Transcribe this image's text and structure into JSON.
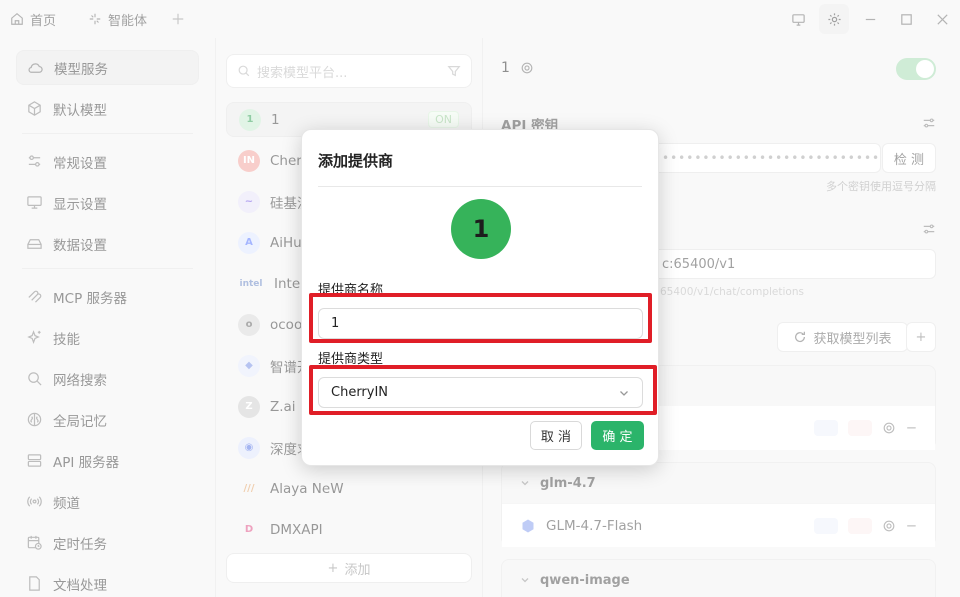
{
  "titlebar": {
    "tabs": [
      {
        "label": "首页",
        "icon": "home-icon"
      },
      {
        "label": "智能体",
        "icon": "sparkle-icon"
      }
    ]
  },
  "nav": {
    "items": [
      {
        "label": "模型服务",
        "icon": "cloud-icon",
        "active": true
      },
      {
        "label": "默认模型",
        "icon": "cube-icon"
      },
      {
        "label": "常规设置",
        "icon": "sliders-icon"
      },
      {
        "label": "显示设置",
        "icon": "monitor-icon"
      },
      {
        "label": "数据设置",
        "icon": "drive-icon"
      },
      {
        "label": "MCP 服务器",
        "icon": "mcp-icon"
      },
      {
        "label": "技能",
        "icon": "sparkles-icon"
      },
      {
        "label": "网络搜索",
        "icon": "search-icon"
      },
      {
        "label": "全局记忆",
        "icon": "brain-icon"
      },
      {
        "label": "API 服务器",
        "icon": "server-icon"
      },
      {
        "label": "频道",
        "icon": "broadcast-icon"
      },
      {
        "label": "定时任务",
        "icon": "calendar-clock-icon"
      },
      {
        "label": "文档处理",
        "icon": "file-icon"
      }
    ]
  },
  "providers": {
    "search_placeholder": "搜索模型平台...",
    "items": [
      {
        "label": "1",
        "badge": "ON",
        "logo_text": "1",
        "logo_color": "#c9ecd2",
        "logo_text_color": "#36a35a"
      },
      {
        "label": "CherryIN",
        "logo_text": "IN",
        "logo_color": "#f2a7a0"
      },
      {
        "label": "硅基流动",
        "logo_text": "~",
        "logo_color": "#e7e3f7",
        "logo_text_color": "#7b5ee6"
      },
      {
        "label": "AiHubMix",
        "logo_text": "A",
        "logo_color": "#dfe7ff",
        "logo_text_color": "#5b7bff"
      },
      {
        "label": "Intel OVMS",
        "logo_text": "intel",
        "logo_color": "transparent",
        "logo_text_color": "#6f8bc6"
      },
      {
        "label": "ocoolAI",
        "logo_text": "o",
        "logo_color": "#d9d9d9",
        "logo_text_color": "#666"
      },
      {
        "label": "智谱开放平台",
        "logo_text": "◆",
        "logo_color": "#e5ebfb",
        "logo_text_color": "#7b93e6"
      },
      {
        "label": "Z.ai",
        "logo_text": "Z",
        "logo_color": "#cfcfcf",
        "logo_text_color": "#fff"
      },
      {
        "label": "深度求索",
        "logo_text": "◉",
        "logo_color": "#dfe5fb",
        "logo_text_color": "#5a78e6"
      },
      {
        "label": "Alaya NeW",
        "logo_text": "///",
        "logo_color": "transparent",
        "logo_text_color": "#e4a66d"
      },
      {
        "label": "DMXAPI",
        "logo_text": "D",
        "logo_color": "transparent",
        "logo_text_color": "#e0568a"
      }
    ],
    "add_label": "添加"
  },
  "detail": {
    "title": "1",
    "api_key_label": "API 密钥",
    "api_key_dots": "••••••••••••••••••••••••••••••",
    "check_label": "检 测",
    "key_hint": "多个密钥使用逗号分隔",
    "api_host": "c:65400/v1",
    "host_hint": "65400/v1/chat/completions",
    "fetch_label": "获取模型列表",
    "groups": [
      {
        "name": "glm-4.7",
        "models": [
          "GLM-4.7-Flash"
        ]
      },
      {
        "name": "qwen-image",
        "models": []
      }
    ]
  },
  "modal": {
    "title": "添加提供商",
    "avatar_text": "1",
    "name_label": "提供商名称",
    "name_value": "1",
    "type_label": "提供商类型",
    "type_value": "CherryIN",
    "cancel_label": "取 消",
    "ok_label": "确 定"
  },
  "colors": {
    "accent_green": "#2bb46a",
    "avatar_green": "#36b35a",
    "highlight_red": "#e01e27"
  }
}
